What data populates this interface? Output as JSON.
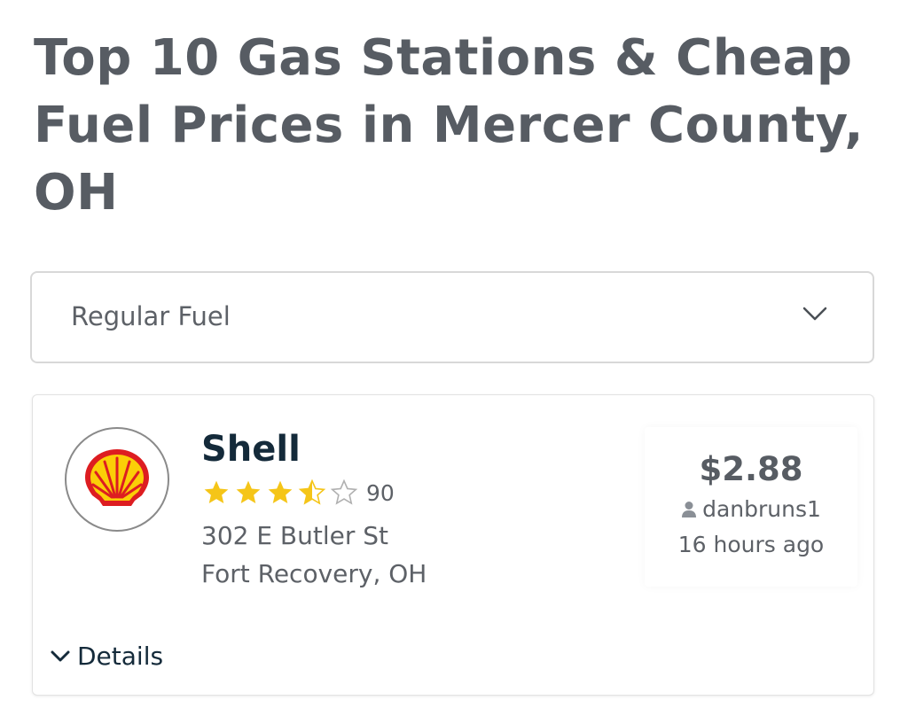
{
  "page": {
    "title": "Top 10 Gas Stations & Cheap Fuel Prices in Mercer County, OH"
  },
  "fuel_select": {
    "value": "Regular Fuel",
    "icon": "chevron-down-icon"
  },
  "station": {
    "name": "Shell",
    "logo": "shell-logo",
    "rating": 3.5,
    "rating_max": 5,
    "rating_count": "90",
    "address_line1": "302 E Butler St",
    "address_line2": "Fort Recovery, OH",
    "price": "$2.88",
    "reporter": "danbruns1",
    "reporter_icon": "user-icon",
    "reported_ago": "16 hours ago",
    "details_label": "Details",
    "details_icon": "chevron-down-icon"
  },
  "colors": {
    "title": "#575c63",
    "star": "#f5c518",
    "station_name": "#142a3a"
  }
}
